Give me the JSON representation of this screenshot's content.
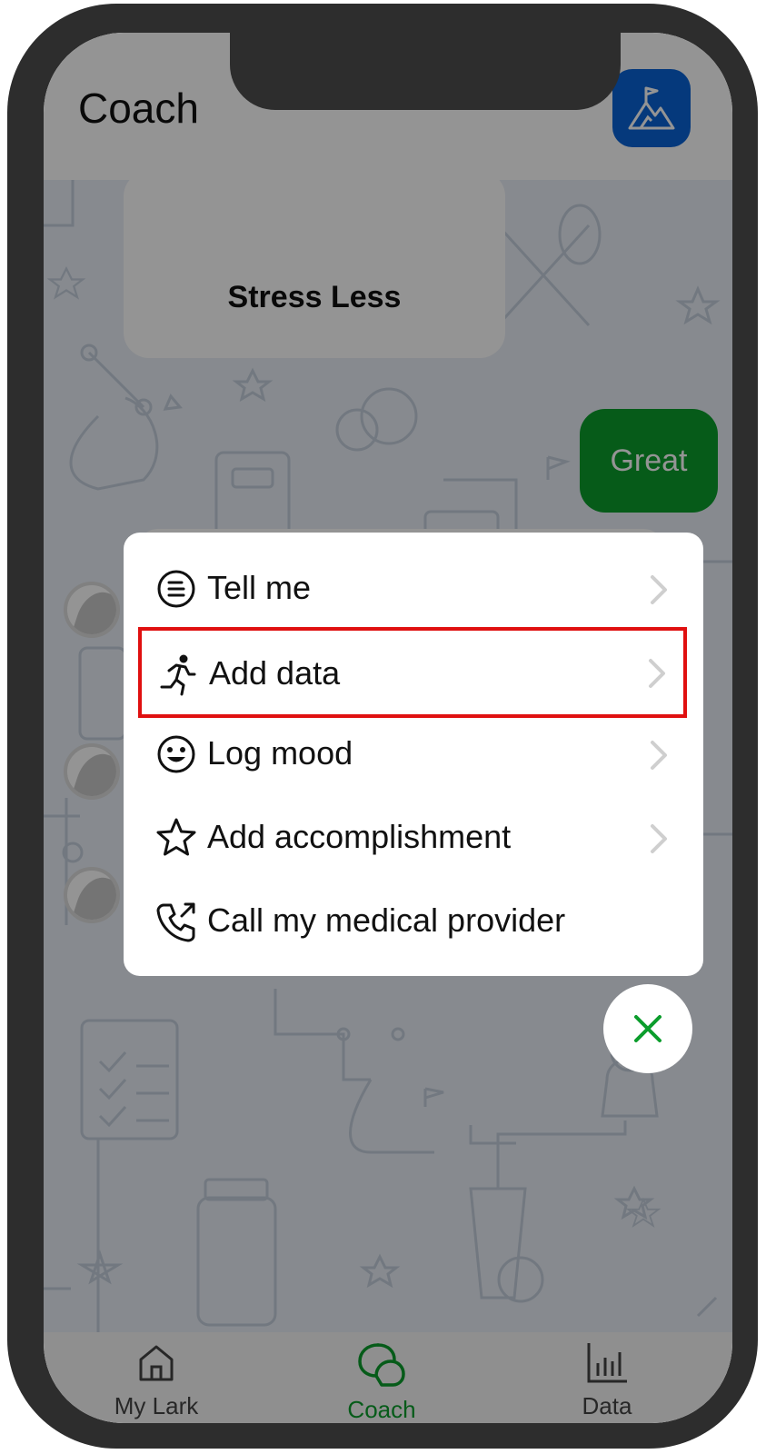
{
  "header": {
    "title": "Coach",
    "goal_icon": "mountain-flag-icon",
    "accent": "#0a63d6"
  },
  "chat": {
    "program_card_title": "Stress Less",
    "reply_bubble": "Great",
    "reply_color": "#0b9d2c"
  },
  "action_menu": {
    "items": [
      {
        "icon": "document-lines-icon",
        "label": "Tell me",
        "has_chevron": true
      },
      {
        "icon": "running-person-icon",
        "label": "Add data",
        "has_chevron": true,
        "highlighted": true
      },
      {
        "icon": "smiley-icon",
        "label": "Log mood",
        "has_chevron": true
      },
      {
        "icon": "star-icon",
        "label": "Add accomplishment",
        "has_chevron": true
      },
      {
        "icon": "phone-call-icon",
        "label": "Call my medical provider",
        "has_chevron": false
      }
    ],
    "highlight_color": "#e01010"
  },
  "close_button": {
    "icon": "close-icon",
    "color": "#0b9d2c"
  },
  "tabbar": {
    "tabs": [
      {
        "icon": "home-icon",
        "label": "My Lark",
        "active": false
      },
      {
        "icon": "chat-bubbles-icon",
        "label": "Coach",
        "active": true
      },
      {
        "icon": "bar-chart-icon",
        "label": "Data",
        "active": false
      }
    ]
  }
}
